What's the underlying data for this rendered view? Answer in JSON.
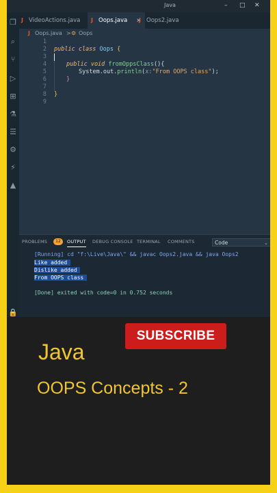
{
  "window": {
    "title": "Java",
    "controls": [
      "–",
      "□",
      "✕"
    ]
  },
  "activity_bar": {
    "icons": [
      "files-icon",
      "search-icon",
      "source-control-icon",
      "run-debug-icon",
      "extensions-icon",
      "testing-icon",
      "java-projects-icon",
      "remote-icon",
      "account-icon",
      "settings-icon"
    ]
  },
  "tabs": [
    {
      "label": "VideoActions.java",
      "active": false
    },
    {
      "label": "Oops.java",
      "active": true
    },
    {
      "label": "Oops2.java",
      "active": false
    }
  ],
  "tab_glyph": "J",
  "close_glyph": "×",
  "breadcrumb": {
    "file": "Oops.java",
    "separator": ">",
    "symbol": "Oops"
  },
  "editor": {
    "line_numbers": [
      "1",
      "2",
      "3",
      "4",
      "5",
      "6",
      "7",
      "8",
      "9"
    ],
    "lines": {
      "l2_kw": "public class",
      "l2_cls": " Oops ",
      "l2_brace": "{",
      "l4_kw": "public void",
      "l4_fn": " fromOppsClass",
      "l4_rest": "(){",
      "l5_obj": "System.out.",
      "l5_fn": "println",
      "l5_open": "(",
      "l5_hint": "x:",
      "l5_str": "\"From OOPS class\"",
      "l5_close": ");",
      "l6": "}",
      "l8": "}"
    }
  },
  "panel": {
    "tabs": [
      "PROBLEMS",
      "OUTPUT",
      "DEBUG CONSOLE",
      "TERMINAL",
      "COMMENTS"
    ],
    "active_tab": "OUTPUT",
    "problems_count": "12",
    "output_channel": "Code",
    "output": {
      "running": "[Running] cd \"f:\\Live\\Java\\\" && javac Oops2.java && java Oops2",
      "line1": "Like added ",
      "line2": "Dislike added ",
      "line3": "From OOPS class ",
      "done": "[Done] exited with code=0 in 0.752 seconds"
    }
  },
  "overlay": {
    "subscribe": "SUBSCRIBE",
    "title": "Java",
    "subtitle": "OOPS Concepts - 2"
  },
  "colors": {
    "frame": "#f7d117",
    "accent_text": "#f1c62e",
    "subscribe_bg": "#cc1c1c",
    "editor_bg": "#253544"
  }
}
